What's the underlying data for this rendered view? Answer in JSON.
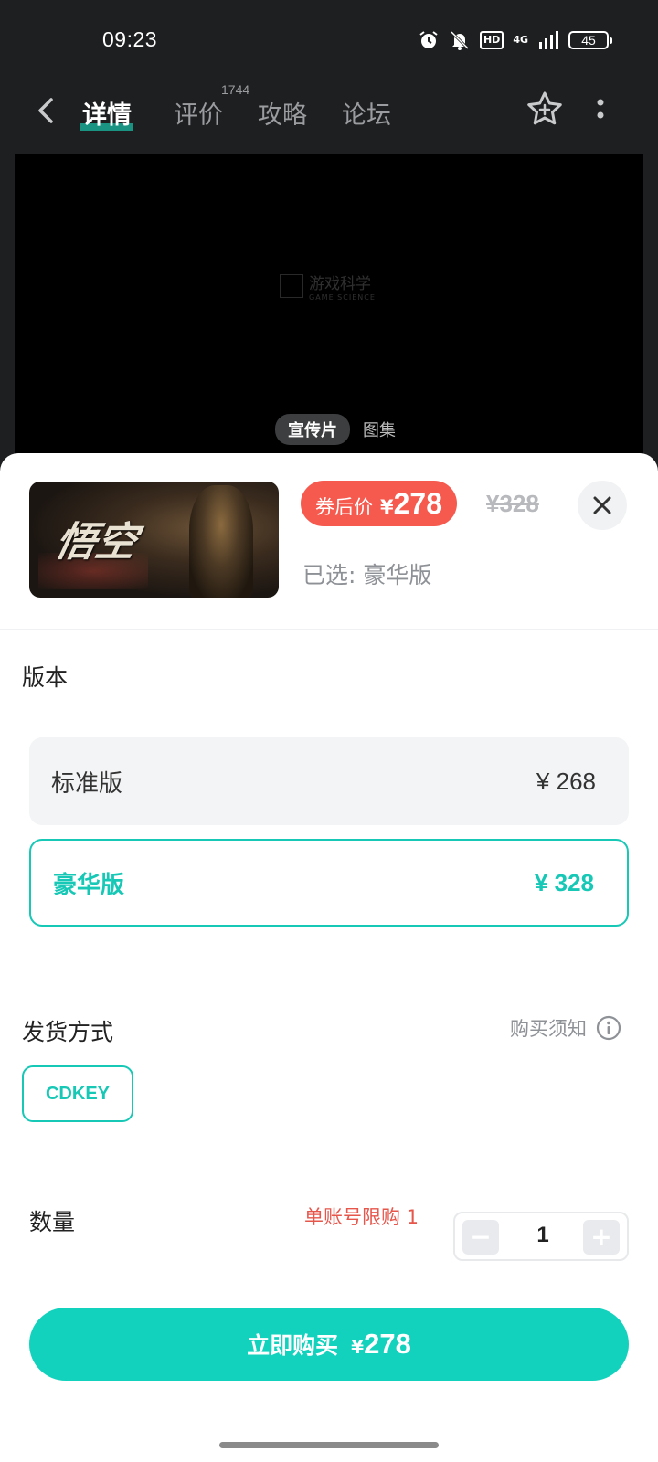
{
  "status_bar": {
    "time": "09:23",
    "hd": "HD",
    "network": "4G",
    "battery": "45"
  },
  "nav": {
    "tabs": [
      {
        "label": "详情"
      },
      {
        "label": "评价",
        "count": "1744"
      },
      {
        "label": "攻略"
      },
      {
        "label": "论坛"
      }
    ]
  },
  "video": {
    "watermark": "游戏科学",
    "watermark_sub": "GAME SCIENCE",
    "tabs": [
      "宣传片",
      "图集"
    ]
  },
  "product": {
    "image_title": "悟空",
    "coupon_label": "券后价",
    "currency": "¥",
    "coupon_price": "278",
    "original_price": "¥328",
    "selected": "已选: 豪华版"
  },
  "version": {
    "title": "版本",
    "options": [
      {
        "name": "标准版",
        "price": "¥ 268"
      },
      {
        "name": "豪华版",
        "price": "¥ 328"
      }
    ]
  },
  "delivery": {
    "title": "发货方式",
    "notice": "购买须知",
    "method": "CDKEY"
  },
  "quantity": {
    "title": "数量",
    "limit": "单账号限购 1",
    "minus": "−",
    "plus": "+",
    "value": "1"
  },
  "buy": {
    "label": "立即购买",
    "currency": "¥",
    "price": "278"
  },
  "colors": {
    "accent": "#12d2be",
    "coupon_badge": "#f65a4f",
    "limit_text": "#e6564b"
  }
}
